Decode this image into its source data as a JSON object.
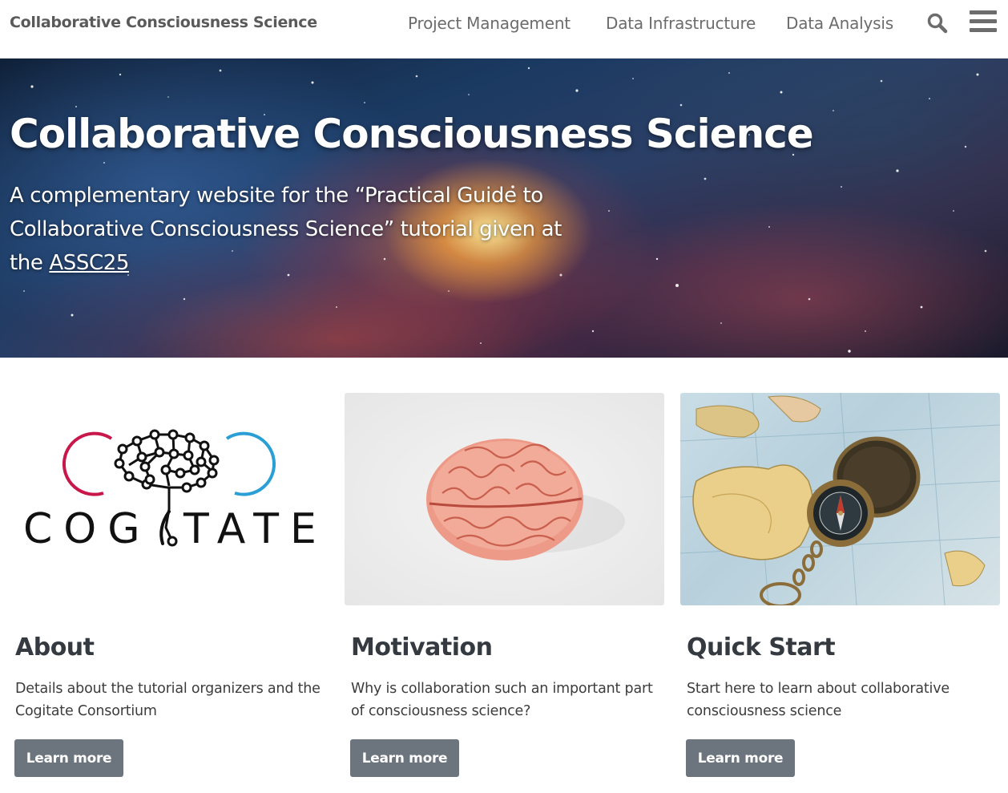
{
  "navbar": {
    "brand": "Collaborative Consciousness Science",
    "links": [
      "Project Management",
      "Data Infrastructure",
      "Data Analysis"
    ],
    "search_icon": "search-icon",
    "menu_icon": "hamburger-menu-icon"
  },
  "hero": {
    "title": "Collaborative Consciousness Science",
    "subtitle_prefix": "A complementary website for the “Practical Guide to Collaborative Consciousness Science” tutorial given at the ",
    "subtitle_link": "ASSC25"
  },
  "cards": [
    {
      "logo_text": "COG TATE",
      "title": "About",
      "text": "Details about the tutorial organizers and the Cogitate Consortium",
      "button": "Learn more"
    },
    {
      "title": "Motivation",
      "text": "Why is collaboration such an important part of consciousness science?",
      "button": "Learn more"
    },
    {
      "title": "Quick Start",
      "text": "Start here to learn about collaborative consciousness science",
      "button": "Learn more"
    }
  ],
  "colors": {
    "button": "#6c757d",
    "cogitate_red": "#c8174b",
    "cogitate_blue": "#2a9fd6"
  }
}
